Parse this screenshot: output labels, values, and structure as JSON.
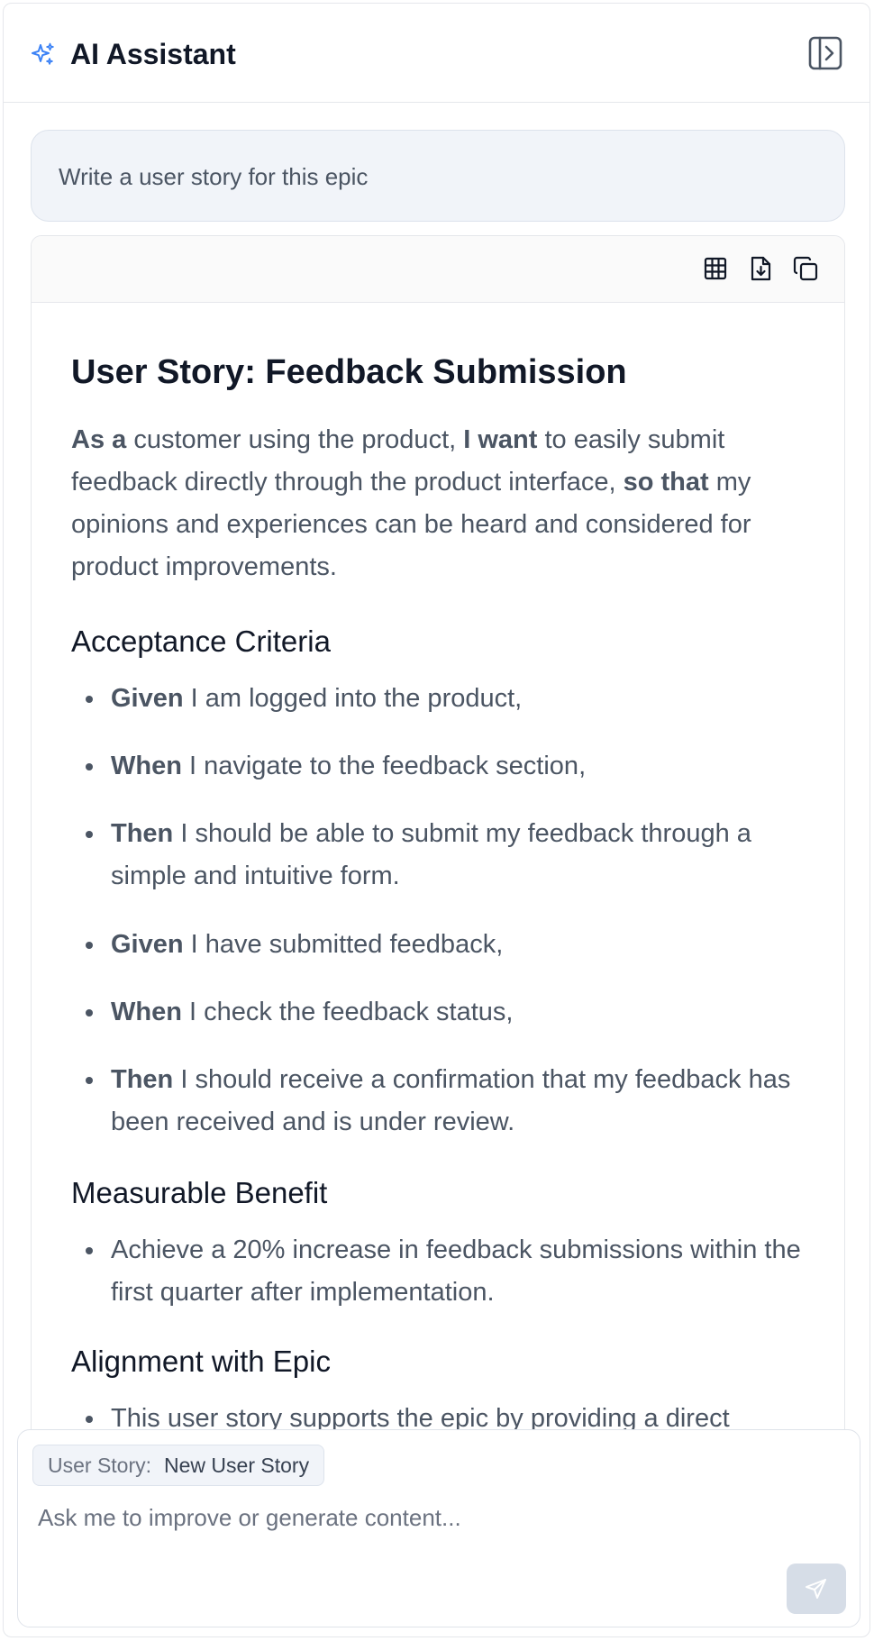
{
  "header": {
    "title": "AI Assistant",
    "icon": "sparkles-icon",
    "toggle_icon": "panel-right-icon",
    "accent_color": "#3b82f6"
  },
  "prompt": {
    "text": "Write a user story for this epic"
  },
  "response": {
    "toolbar": [
      "table-icon",
      "download-file-icon",
      "copy-icon"
    ],
    "title": "User Story: Feedback Submission",
    "story": {
      "as_a_label": "As a",
      "as_a_text": " customer using the product, ",
      "i_want_label": "I want",
      "i_want_text": " to easily submit feedback directly through the product interface, ",
      "so_that_label": "so that",
      "so_that_text": " my opinions and experiences can be heard and considered for product improvements."
    },
    "acceptance_heading": "Acceptance Criteria",
    "acceptance_criteria": [
      {
        "keyword": "Given",
        "text": " I am logged into the product,"
      },
      {
        "keyword": "When",
        "text": " I navigate to the feedback section,"
      },
      {
        "keyword": "Then",
        "text": " I should be able to submit my feedback through a simple and intuitive form."
      },
      {
        "keyword": "Given",
        "text": " I have submitted feedback,"
      },
      {
        "keyword": "When",
        "text": " I check the feedback status,"
      },
      {
        "keyword": "Then",
        "text": " I should receive a confirmation that my feedback has been received and is under review."
      }
    ],
    "benefit_heading": "Measurable Benefit",
    "benefits": [
      "Achieve a 20% increase in feedback submissions within the first quarter after implementation."
    ],
    "alignment_heading": "Alignment with Epic",
    "alignment": [
      "This user story supports the epic by providing a direct"
    ]
  },
  "composer": {
    "chip_label": "User Story:",
    "chip_value": "New User Story",
    "placeholder": "Ask me to improve or generate content...",
    "send_icon": "send-icon"
  }
}
